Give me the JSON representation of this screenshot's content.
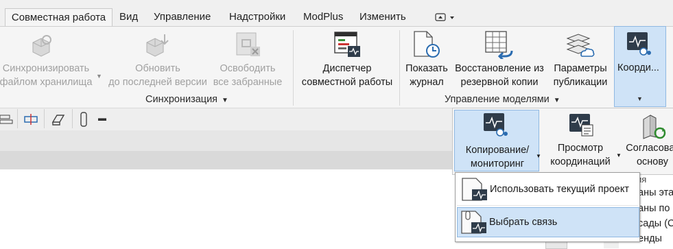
{
  "tabs": [
    "Совместная работа",
    "Вид",
    "Управление",
    "Надстройки",
    "ModPlus",
    "Изменить"
  ],
  "ribbon": {
    "sync_button": [
      "Синхронизировать",
      "файлом хранилища"
    ],
    "update_button": [
      "Обновить",
      "до последней версии"
    ],
    "release_button": [
      "Освободить",
      "все забранные"
    ],
    "dispatcher_button": [
      "Диспетчер",
      "совместной работы"
    ],
    "show_log_button": [
      "Показать",
      "журнал"
    ],
    "restore_button": [
      "Восстановление из",
      "резервной копии"
    ],
    "publish_button": [
      "Параметры",
      "публикации"
    ],
    "coord_button": "Коорди...",
    "panel_sync": "Синхронизация",
    "panel_models": "Управление моделями"
  },
  "dropdown": {
    "copy_monitor": [
      "Копирование/",
      "мониторинг"
    ],
    "view_coord": [
      "Просмотр",
      "координаций"
    ],
    "agree": [
      "Согласоват",
      "основу"
    ],
    "partial_label": "ия"
  },
  "menu": {
    "item1": "Использовать текущий проект",
    "item2": "Выбрать связь"
  },
  "right_list": [
    "аны эта",
    "аны по",
    "сады (С",
    "енды"
  ],
  "colors": {
    "accent": "#cfe3f7",
    "accent_border": "#8fb8e2",
    "disabled": "#a0a0a0"
  }
}
